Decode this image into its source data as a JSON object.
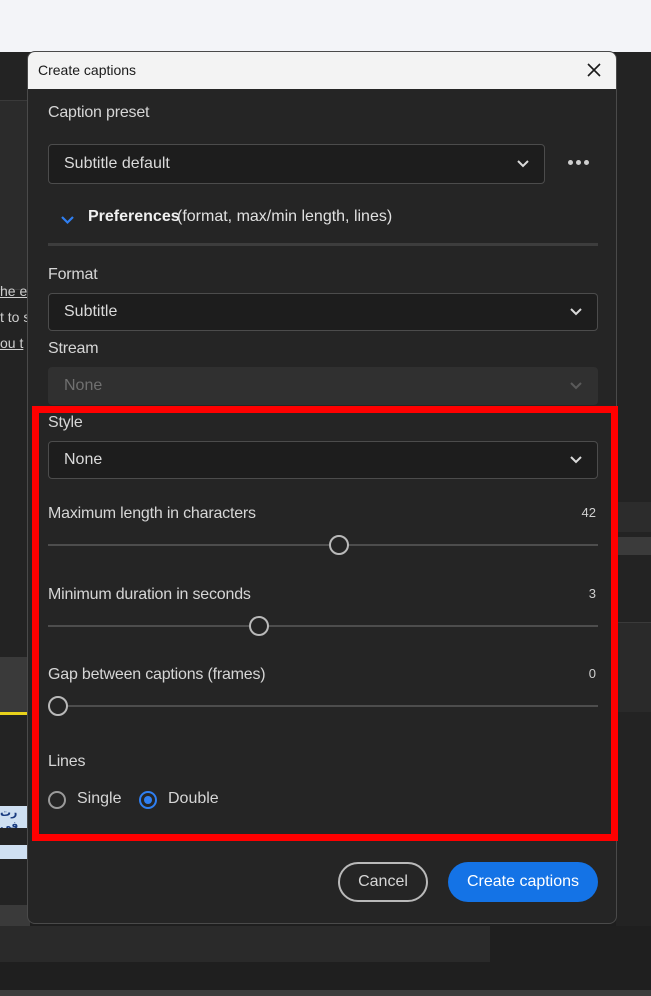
{
  "dialog": {
    "title": "Create captions"
  },
  "preset": {
    "label": "Caption preset",
    "value": "Subtitle default"
  },
  "preferences": {
    "title": "Preferences",
    "subtitle": "(format, max/min length, lines)"
  },
  "format": {
    "label": "Format",
    "value": "Subtitle"
  },
  "stream": {
    "label": "Stream",
    "value": "None"
  },
  "style": {
    "label": "Style",
    "value": "None"
  },
  "max_length": {
    "label": "Maximum length in characters",
    "value": "42",
    "fraction": 0.53
  },
  "min_duration": {
    "label": "Minimum duration in seconds",
    "value": "3",
    "fraction": 0.38
  },
  "gap": {
    "label": "Gap between captions (frames)",
    "value": "0",
    "fraction": 0.0
  },
  "lines": {
    "label": "Lines",
    "options": [
      "Single",
      "Double"
    ],
    "selected": "Double"
  },
  "buttons": {
    "cancel": "Cancel",
    "create": "Create captions"
  },
  "background": {
    "frag1": "he e",
    "frag2": "t to s",
    "frag3": "ou t",
    "clip_text": "رت في"
  },
  "colors": {
    "accent": "#1473e6",
    "highlight": "#ff0000"
  }
}
